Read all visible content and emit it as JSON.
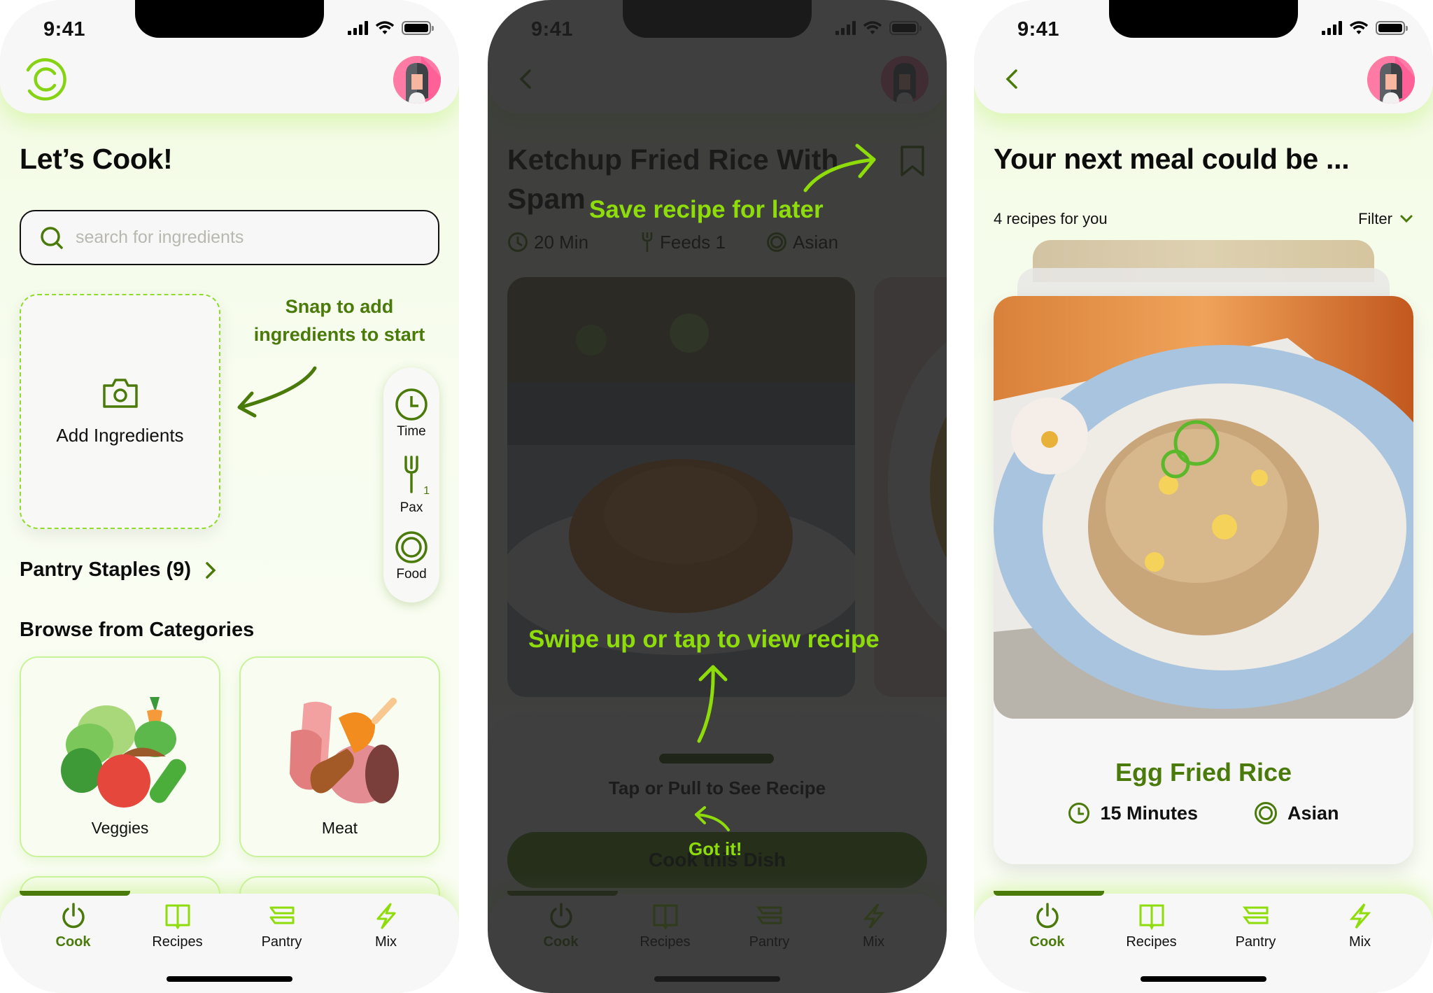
{
  "status_bar": {
    "time": "9:41"
  },
  "colors": {
    "accent_dark": "#4a7a0a",
    "accent_bright": "#8edc0a",
    "card_border": "#c9f39a",
    "overlay": "#3d3d3d"
  },
  "tabs": [
    {
      "label": "Cook",
      "icon": "power-icon",
      "active": true
    },
    {
      "label": "Recipes",
      "icon": "book-icon",
      "active": false
    },
    {
      "label": "Pantry",
      "icon": "pantry-shelves-icon",
      "active": false
    },
    {
      "label": "Mix",
      "icon": "lightning-icon",
      "active": false
    }
  ],
  "screen1": {
    "title": "Let’s Cook!",
    "search": {
      "placeholder": "search for ingredients",
      "value": ""
    },
    "add_card_label": "Add Ingredients",
    "annotation": [
      "Snap to add",
      "ingredients to start"
    ],
    "filters": [
      {
        "label": "Time",
        "icon": "clock-icon"
      },
      {
        "label": "Pax",
        "icon": "fork-icon",
        "badge": "1"
      },
      {
        "label": "Food",
        "icon": "plate-icon"
      }
    ],
    "pantry_title": "Pantry Staples (9)",
    "browse_title": "Browse from Categories",
    "categories": [
      {
        "label": "Veggies",
        "icon": "veggies-illustration"
      },
      {
        "label": "Meat",
        "icon": "meat-illustration"
      }
    ]
  },
  "screen2": {
    "recipe_title": "Ketchup Fried Rice With Spam",
    "meta": {
      "time": "20 Min",
      "feeds": "Feeds 1",
      "cuisine": "Asian"
    },
    "sheet_hint": "Tap or Pull to See Recipe",
    "cook_button": "Cook this Dish",
    "coach": {
      "save_hint": "Save recipe for later",
      "swipe_hint": "Swipe up or tap to view recipe",
      "dismiss": "Got it!"
    }
  },
  "screen3": {
    "title": "Your next meal could be ...",
    "count_label": "4 recipes for you",
    "filter_label": "Filter",
    "recipe": {
      "name": "Egg Fried Rice",
      "time": "15 Minutes",
      "cuisine": "Asian"
    }
  }
}
